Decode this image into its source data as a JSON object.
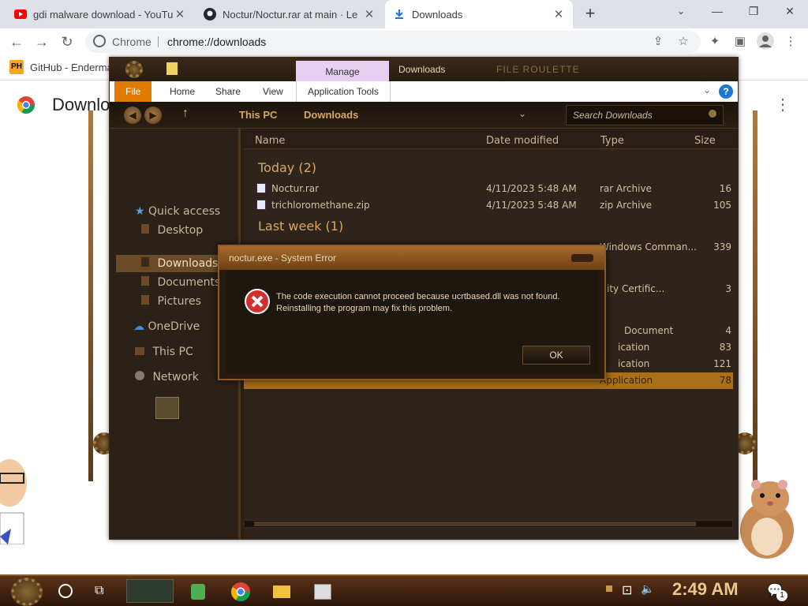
{
  "browser": {
    "tabs": [
      {
        "title": "gdi malware download - YouTube",
        "icon": "youtube-icon",
        "active": false
      },
      {
        "title": "Noctur/Noctur.rar at main · Le",
        "icon": "github-icon",
        "active": false
      },
      {
        "title": "Downloads",
        "icon": "download-icon",
        "active": true
      }
    ],
    "new_tab": "+",
    "window_controls": {
      "minimize": "—",
      "restore": "❐",
      "close": "✕"
    },
    "omnibox": {
      "chip": "Chrome",
      "url": "chrome://downloads"
    },
    "bookmark": {
      "logo": "PH",
      "label": "GitHub - Endermax"
    },
    "page_title": "Downloads"
  },
  "explorer": {
    "title_right": "FILE ROULETTE",
    "ribbon": {
      "context_group": "Manage",
      "context_title": "Downloads",
      "tabs": [
        "File",
        "Home",
        "Share",
        "View",
        "Application Tools"
      ]
    },
    "breadcrumb": [
      "This PC",
      "Downloads"
    ],
    "search_placeholder": "Search Downloads",
    "nav": {
      "quick_access": "Quick access",
      "items": [
        "Desktop",
        "Downloads",
        "Documents",
        "Pictures"
      ],
      "onedrive": "OneDrive",
      "this_pc": "This PC",
      "network": "Network"
    },
    "columns": {
      "name": "Name",
      "date": "Date modified",
      "type": "Type",
      "size": "Size"
    },
    "groups": [
      {
        "label": "Today (2)",
        "rows": [
          {
            "name": "Noctur.rar",
            "date": "4/11/2023 5:48 AM",
            "type": "rar Archive",
            "size": "16"
          },
          {
            "name": "trichloromethane.zip",
            "date": "4/11/2023 5:48 AM",
            "type": "zip Archive",
            "size": "105"
          }
        ]
      },
      {
        "label": "Last week (1)",
        "rows": [
          {
            "name": "",
            "date": "",
            "type": "Windows Comman...",
            "size": "339"
          }
        ]
      }
    ],
    "partial_rows": [
      {
        "type": "ity Certific...",
        "size": "3"
      },
      {
        "type": "Document",
        "size": "4"
      },
      {
        "type": "ication",
        "size": "83"
      },
      {
        "type": "ication",
        "size": "121"
      },
      {
        "type": "Application",
        "size": "78"
      }
    ]
  },
  "dialog": {
    "title": "noctur.exe - System Error",
    "message_line1": "The code execution cannot proceed because ucrtbased.dll was not found.",
    "message_line2": "Reinstalling the program may fix this problem.",
    "ok_label": "OK"
  },
  "taskbar": {
    "clock": "2:49 AM",
    "notification_count": "1"
  },
  "colors": {
    "accent_bronze": "#8a5a28",
    "explorer_bg": "#2e241b",
    "error_red": "#d32f2f",
    "file_tab_orange": "#e07b00",
    "clock_gold": "#e8c98a"
  }
}
